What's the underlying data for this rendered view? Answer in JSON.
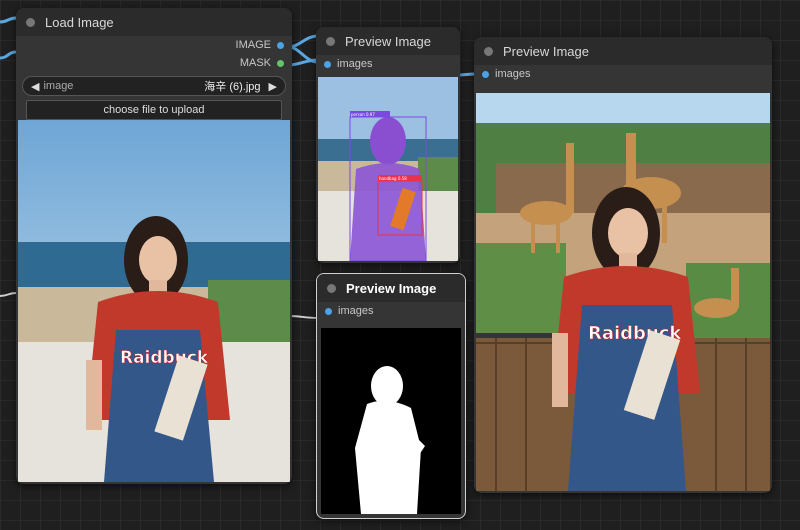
{
  "nodes": {
    "load_image": {
      "title": "Load Image",
      "output_image": "IMAGE",
      "output_mask": "MASK",
      "widget_name": "image",
      "widget_value": "海辛 (6).jpg",
      "prev_arrow": "◀",
      "next_arrow": "▶",
      "upload_label": "choose file to upload",
      "preview_caption": "Raidbuck"
    },
    "preview_detect": {
      "title": "Preview Image",
      "input_label": "images",
      "label_person": "person 0.97",
      "label_object": "handbag 0.58"
    },
    "preview_mask": {
      "title": "Preview Image",
      "input_label": "images"
    },
    "preview_result": {
      "title": "Preview Image",
      "input_label": "images",
      "preview_caption": "Raidbuck"
    }
  },
  "colors": {
    "slot_image": "#4aa3e6",
    "slot_mask": "#66c36b",
    "node_bg": "#353535",
    "header_bg": "#2b2b2b"
  }
}
